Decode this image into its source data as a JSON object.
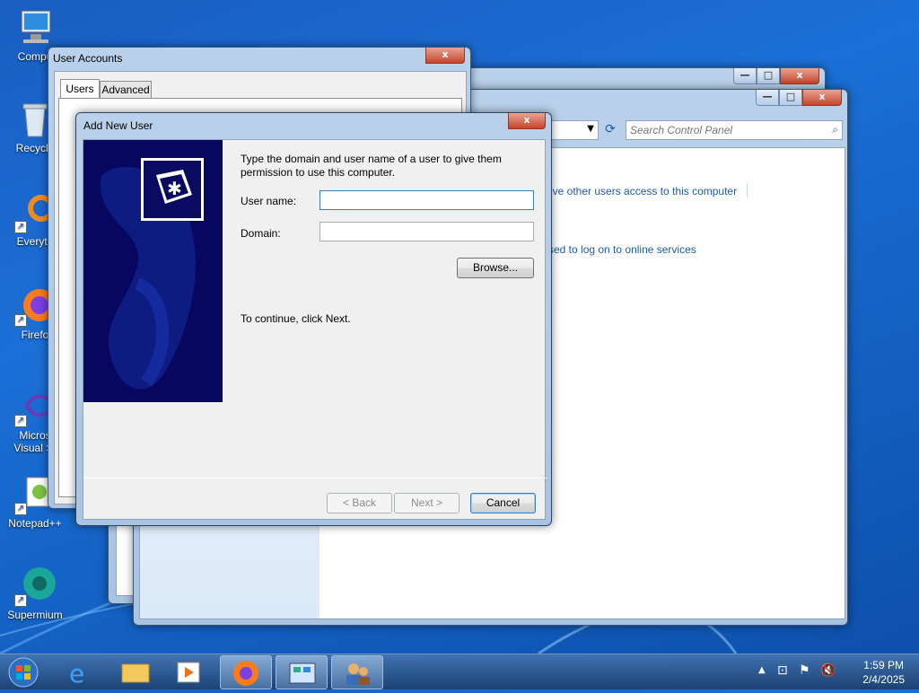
{
  "desktop": {
    "icons": [
      {
        "label": "Compu",
        "icon": "computer-icon"
      },
      {
        "label": "Recycle",
        "icon": "recycle-bin-icon"
      },
      {
        "label": "Everyth",
        "icon": "everything-icon"
      },
      {
        "label": "Firefo",
        "icon": "firefox-icon"
      },
      {
        "label": "Micros",
        "label2": "Visual St",
        "icon": "visual-studio-icon"
      },
      {
        "label": "Notepad++",
        "icon": "notepad-plus-icon"
      },
      {
        "label": "Supermium",
        "icon": "supermium-icon"
      }
    ]
  },
  "control_panel": {
    "search_placeholder": "Search Control Panel",
    "link1": "ive other users access to this computer",
    "link2": "sed to log on to online services"
  },
  "user_accounts": {
    "title": "User Accounts",
    "tabs": [
      "Users",
      "Advanced"
    ]
  },
  "dialog": {
    "title": "Add New User",
    "intro": "Type the domain and user name of a user to give them permission to use this computer.",
    "intro_line1": "Type the domain and user name of a user to give them",
    "intro_line2": "permission to use this computer.",
    "username_label": "User name:",
    "username_value": "",
    "domain_label": "Domain:",
    "domain_value": "",
    "browse_label": "Browse...",
    "continue_text": "To continue, click Next.",
    "back_label": "< Back",
    "next_label": "Next >",
    "cancel_label": "Cancel",
    "close_label": "x"
  },
  "window_controls": {
    "minimize": "—",
    "maximize": "□",
    "close": "x"
  },
  "taskbar": {
    "items": [
      "start-orb",
      "internet-explorer-icon",
      "file-explorer-icon",
      "media-player-icon",
      "firefox-icon",
      "control-panel-icon",
      "user-accounts-icon"
    ],
    "time": "1:59 PM",
    "date": "2/4/2025"
  },
  "colors": {
    "accent": "#1e5ba6",
    "banner": "#070760"
  }
}
